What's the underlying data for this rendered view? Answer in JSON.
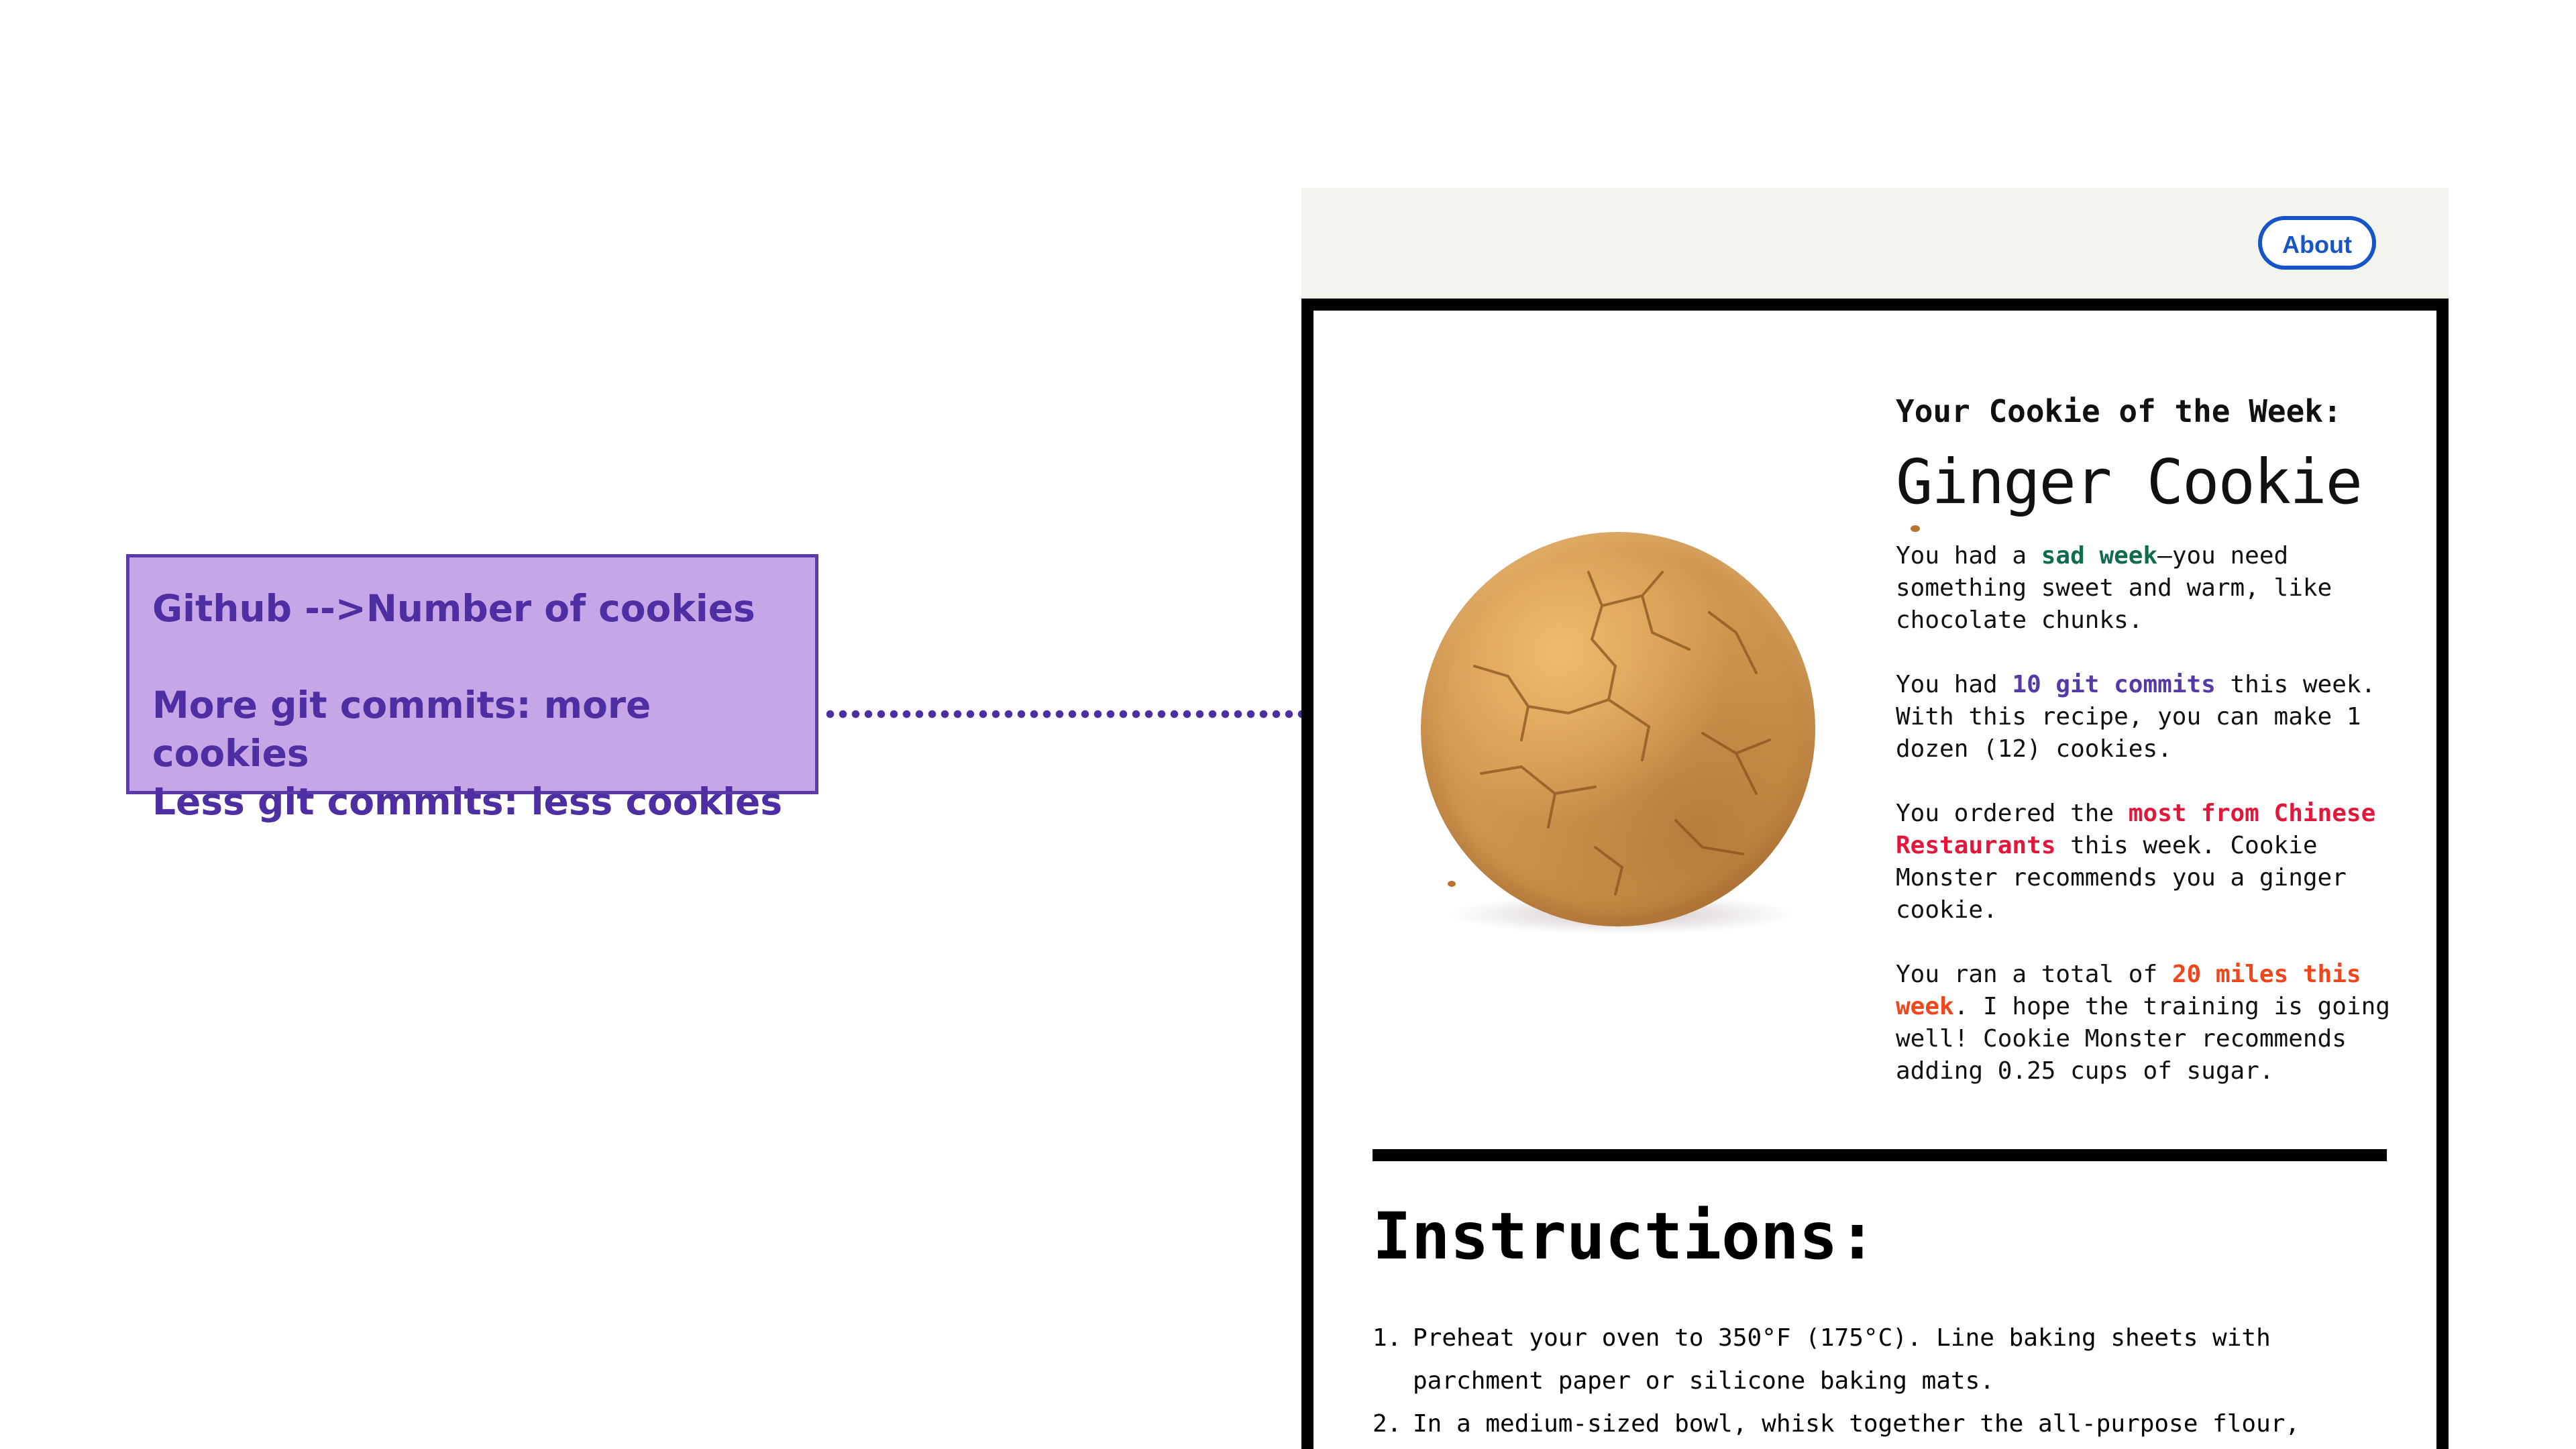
{
  "annotation": {
    "line1": "Github -->Number of cookies",
    "line2": "More git commits: more cookies",
    "line3": "Less git commits: less cookies"
  },
  "header": {
    "about_label": "About"
  },
  "cookie": {
    "image_alt": "ginger cookie"
  },
  "card": {
    "subheading": "Your Cookie of the Week:",
    "cookie_name": "Ginger Cookie",
    "p1": {
      "a": "You had a ",
      "b": "sad week",
      "c": "—you need something sweet and warm, like chocolate chunks."
    },
    "p2": {
      "a": "You had ",
      "b": "10 git commits",
      "c": " this week. With this recipe, you can make 1 dozen (12) cookies."
    },
    "p3": {
      "a": "You ordered the ",
      "b": "most from Chinese Restaurants",
      "c": " this week. Cookie Monster recommends you a ginger cookie."
    },
    "p4": {
      "a": "You ran a total of ",
      "b": "20 miles this week",
      "c": ". I hope the training is going well! Cookie Monster recommends adding 0.25 cups of sugar."
    },
    "instructions_title": "Instructions:",
    "steps": [
      {
        "num": "1.",
        "text": "Preheat your oven to 350°F (175°C). Line baking sheets with parchment paper or silicone baking mats."
      },
      {
        "num": "2.",
        "text": "In a medium-sized bowl, whisk together the all-purpose flour,"
      }
    ]
  },
  "colors": {
    "accent_purple": "#4d2ea3",
    "callout_fill": "#c6a6e6",
    "about_blue": "#1655c8",
    "green": "#116b4f",
    "red": "#e1173c",
    "orange": "#f0461b"
  }
}
